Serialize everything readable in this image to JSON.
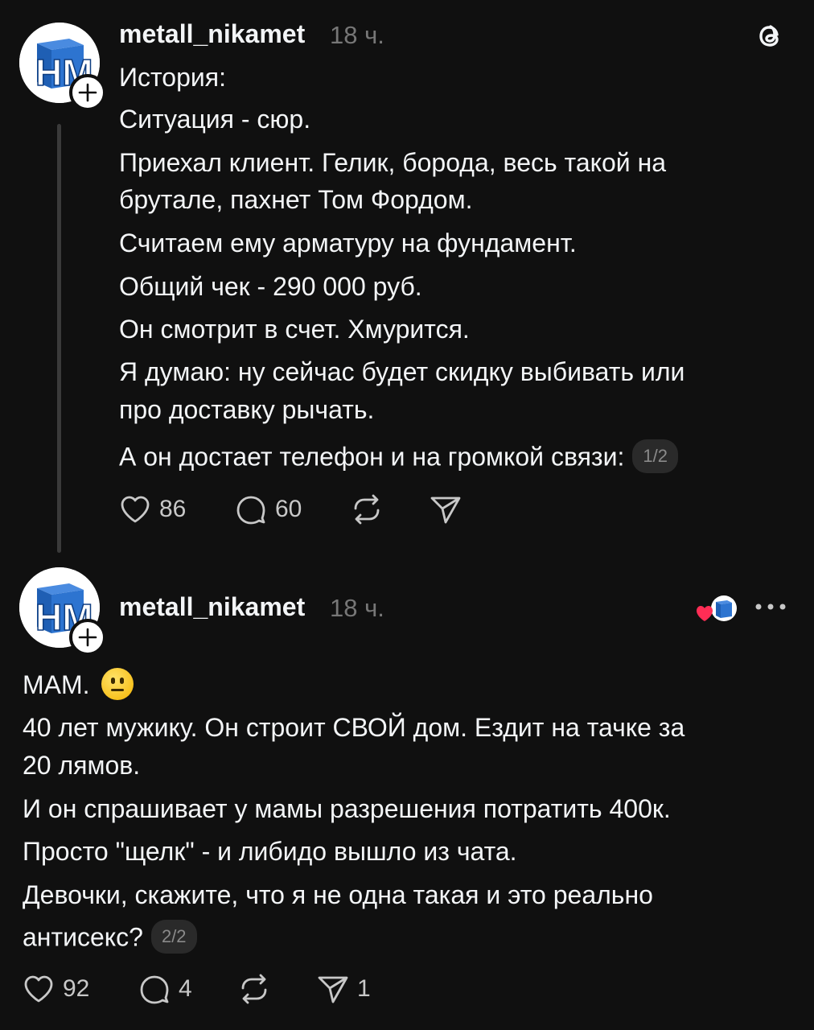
{
  "post1": {
    "username": "metall_nikamet",
    "time": "18 ч.",
    "lines": [
      "История:",
      "Ситуация - сюр.",
      "Приехал клиент. Гелик, борода, весь такой на",
      "брутале, пахнет Том Фордом.",
      "Считаем ему арматуру на фундамент.",
      "Общий чек - 290 000 руб.",
      "Он смотрит в счет. Хмурится.",
      "Я думаю: ну сейчас будет скидку выбивать или",
      "про доставку рычать.",
      "А он достает телефон и на громкой связи:"
    ],
    "pager": "1/2",
    "likes": "86",
    "comments": "60"
  },
  "post2": {
    "username": "metall_nikamet",
    "time": "18 ч.",
    "first_line": "МАМ.",
    "lines": [
      "40 лет мужику. Он строит СВОЙ дом. Ездит на тачке за",
      "20 лямов.",
      "И он спрашивает у мамы разрешения потратить 400к.",
      "Просто \"щелк\" - и либидо вышло из чата.",
      "Девочки, скажите, что я не одна такая и это реально",
      "антисекс?"
    ],
    "pager": "2/2",
    "likes": "92",
    "comments": "4",
    "shares": "1"
  },
  "avatar_logo_text": "НМ",
  "icons": {
    "threads": "threads-logo-icon",
    "like": "heart-icon",
    "comment": "comment-icon",
    "repost": "repost-icon",
    "share": "send-icon",
    "more": "more-icon",
    "liked_by_author": "liked-by-author-icon"
  },
  "colors": {
    "background": "#101010",
    "text": "#f3f5f7",
    "muted": "#777777",
    "logo_blue": "#1f5fb4",
    "like_red": "#ff2d55"
  }
}
